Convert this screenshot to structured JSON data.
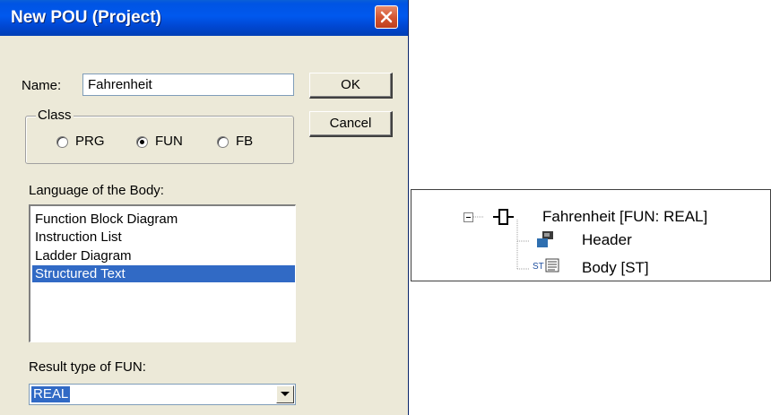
{
  "dialog": {
    "title": "New POU (Project)",
    "name_label": "Name:",
    "name_value": "Fahrenheit",
    "ok_label": "OK",
    "cancel_label": "Cancel",
    "class_group": {
      "legend": "Class",
      "options": [
        {
          "label": "PRG",
          "checked": false
        },
        {
          "label": "FUN",
          "checked": true
        },
        {
          "label": "FB",
          "checked": false
        }
      ]
    },
    "language_label": "Language of the Body:",
    "languages": [
      {
        "label": "Function Block Diagram",
        "selected": false
      },
      {
        "label": "Instruction List",
        "selected": false
      },
      {
        "label": "Ladder Diagram",
        "selected": false
      },
      {
        "label": "Structured Text",
        "selected": true
      }
    ],
    "result_label": "Result type of FUN:",
    "result_value": "REAL"
  },
  "tree": {
    "root": {
      "label": "Fahrenheit [FUN: REAL]",
      "icon": "function-icon",
      "expanded": true
    },
    "children": [
      {
        "label": "Header",
        "icon": "header-icon"
      },
      {
        "label": "Body [ST]",
        "icon": "structured-text-icon",
        "icon_text": "ST"
      }
    ]
  },
  "colors": {
    "titlebar": "#0058ee",
    "dialog_bg": "#ece9d8",
    "selection": "#316ac5",
    "close_button": "#d2532f"
  }
}
